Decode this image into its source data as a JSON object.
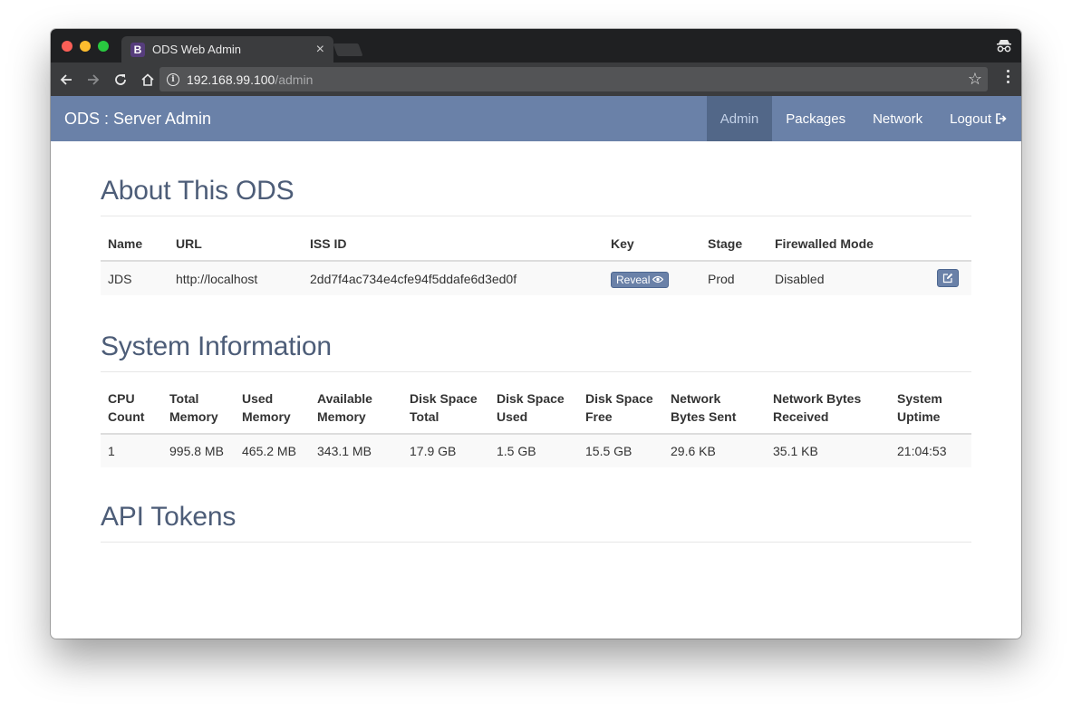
{
  "browser": {
    "tab_title": "ODS Web Admin",
    "tab_favicon": "B",
    "url_host": "192.168.99.100",
    "url_path": "/admin"
  },
  "navbar": {
    "brand": "ODS : Server Admin",
    "links": [
      "Admin",
      "Packages",
      "Network",
      "Logout"
    ],
    "active": "Admin"
  },
  "about": {
    "heading": "About This ODS",
    "headers": [
      "Name",
      "URL",
      "ISS ID",
      "Key",
      "Stage",
      "Firewalled Mode"
    ],
    "row": {
      "name": "JDS",
      "url": "http://localhost",
      "iss_id": "2dd7f4ac734e4cfe94f5ddafe6d3ed0f",
      "key_button": "Reveal",
      "stage": "Prod",
      "firewalled_mode": "Disabled"
    }
  },
  "system": {
    "heading": "System Information",
    "headers": [
      [
        "CPU",
        "Count"
      ],
      [
        "Total",
        "Memory"
      ],
      [
        "Used",
        "Memory"
      ],
      [
        "Available",
        "Memory"
      ],
      [
        "Disk Space",
        "Total"
      ],
      [
        "Disk Space",
        "Used"
      ],
      [
        "Disk Space",
        "Free"
      ],
      [
        "Network",
        "Bytes Sent"
      ],
      [
        "Network Bytes",
        "Received"
      ],
      [
        "System",
        "Uptime"
      ]
    ],
    "values": [
      "1",
      "995.8 MB",
      "465.2 MB",
      "343.1 MB",
      "17.9 GB",
      "1.5 GB",
      "15.5 GB",
      "29.6 KB",
      "35.1 KB",
      "21:04:53"
    ]
  },
  "api": {
    "heading": "API Tokens"
  }
}
